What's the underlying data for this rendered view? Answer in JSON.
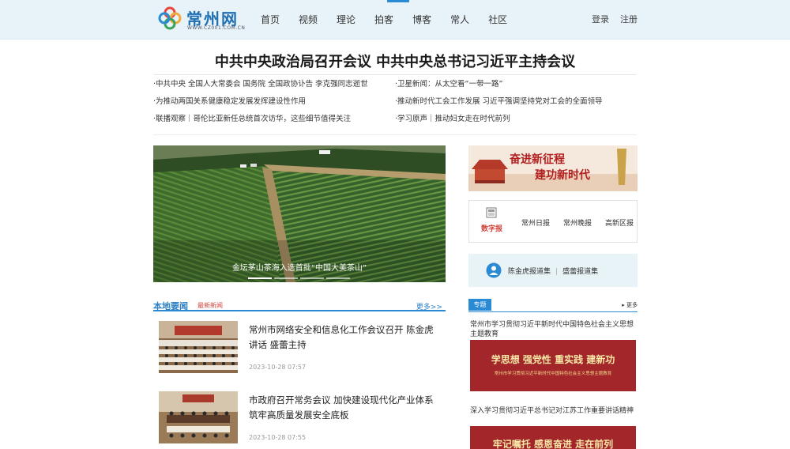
{
  "header": {
    "site_name": "常州网",
    "site_url": "WWW.CZ001.COM.CN",
    "nav": [
      "首页",
      "视频",
      "理论",
      "拍客",
      "博客",
      "常人",
      "社区"
    ],
    "login": "登录",
    "register": "注册"
  },
  "headline": "中共中央政治局召开会议 中共中央总书记习近平主持会议",
  "news_left": [
    "·中共中央 全国人大常委会 国务院 全国政协讣告 李克强同志逝世",
    "·为推动两国关系健康稳定发展发挥建设性作用",
    "·联播观察｜哥伦比亚新任总统首次访华，这些细节值得关注"
  ],
  "news_right": [
    "·卫星新闻：从太空看“一带一路”",
    "·推动新时代工会工作发展 习近平强调坚持党对工会的全面领导",
    "·学习原声｜推动妇女走在时代前列"
  ],
  "hero": {
    "caption": "金坛茅山茶海入选首批“中国大美茶山”"
  },
  "local": {
    "title": "本地要闻",
    "subtitle": "最新新闻",
    "more": "更多>>",
    "articles": [
      {
        "title": "常州市网络安全和信息化工作会议召开 陈金虎讲话 盛蕾主持",
        "time": "2023-10-28 07:57"
      },
      {
        "title": "市政府召开常务会议 加快建设现代化产业体系 筑牢高质量发展安全底板",
        "time": "2023-10-28 07:55"
      }
    ]
  },
  "sidebar": {
    "banner_text_1": "奋进新征程",
    "banner_text_2": "建功新时代",
    "epaper_label": "数字报",
    "epaper_links": [
      "常州日报",
      "常州晚报",
      "高新区报"
    ],
    "report_links": [
      "陈金虎报道集",
      "盛蕾报道集"
    ],
    "topic_tag": "专题",
    "topic_more": "更多",
    "topics": [
      {
        "title": "常州市学习贯彻习近平新时代中国特色社会主义思想主题教育",
        "banner_main": "学思想  强党性  重实践  建新功",
        "banner_sub": "常州市学习贯彻习近平新时代中国特色社会主义思想主题教育"
      },
      {
        "title": "深入学习贯彻习近平总书记对江苏工作重要讲话精神",
        "banner_main": "牢记嘱托  感恩奋进  走在前列"
      }
    ]
  },
  "colors": {
    "accent_blue": "#2a8ad4",
    "header_bg": "#e8f3f9",
    "topic_red": "#a3262a"
  }
}
